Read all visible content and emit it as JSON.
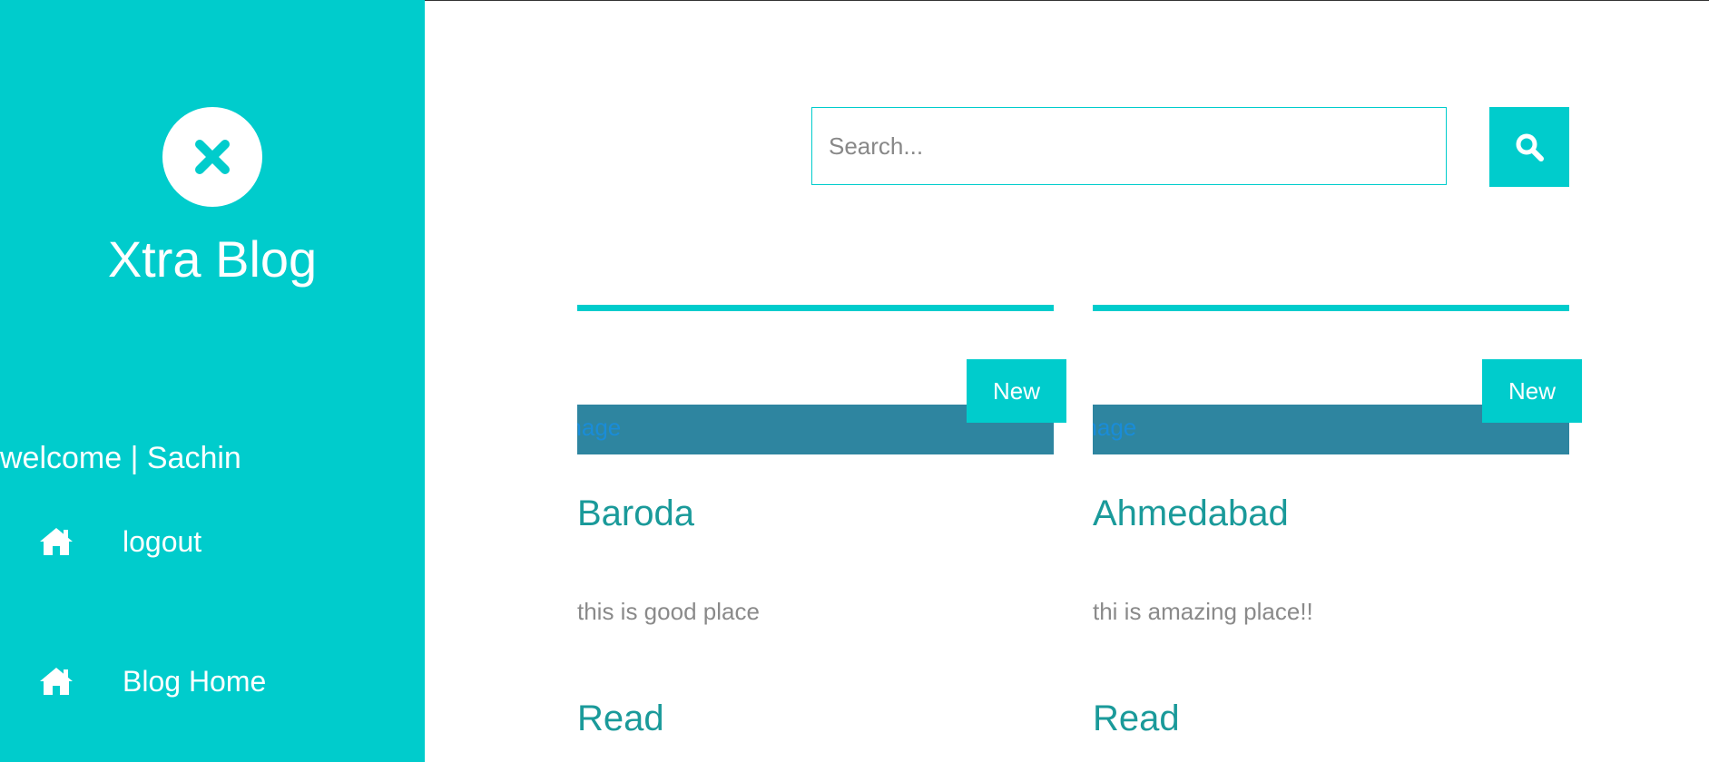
{
  "sidebar": {
    "brand": "Xtra Blog",
    "welcome": "welcome | Sachin",
    "nav": [
      {
        "label": "logout",
        "icon": "home-icon"
      },
      {
        "label": "Blog Home",
        "icon": "home-icon"
      }
    ]
  },
  "search": {
    "placeholder": "Search...",
    "value": ""
  },
  "posts": [
    {
      "badge": "New",
      "image_alt": "Image",
      "title": "Baroda",
      "description": "this is good place",
      "read_label": "Read"
    },
    {
      "badge": "New",
      "image_alt": "Image",
      "title": "Ahmedabad",
      "description": "thi is amazing place!!",
      "read_label": "Read"
    }
  ],
  "colors": {
    "accent": "#00cccc",
    "image_placeholder": "#2e85a0",
    "link": "#1a9a9a"
  }
}
